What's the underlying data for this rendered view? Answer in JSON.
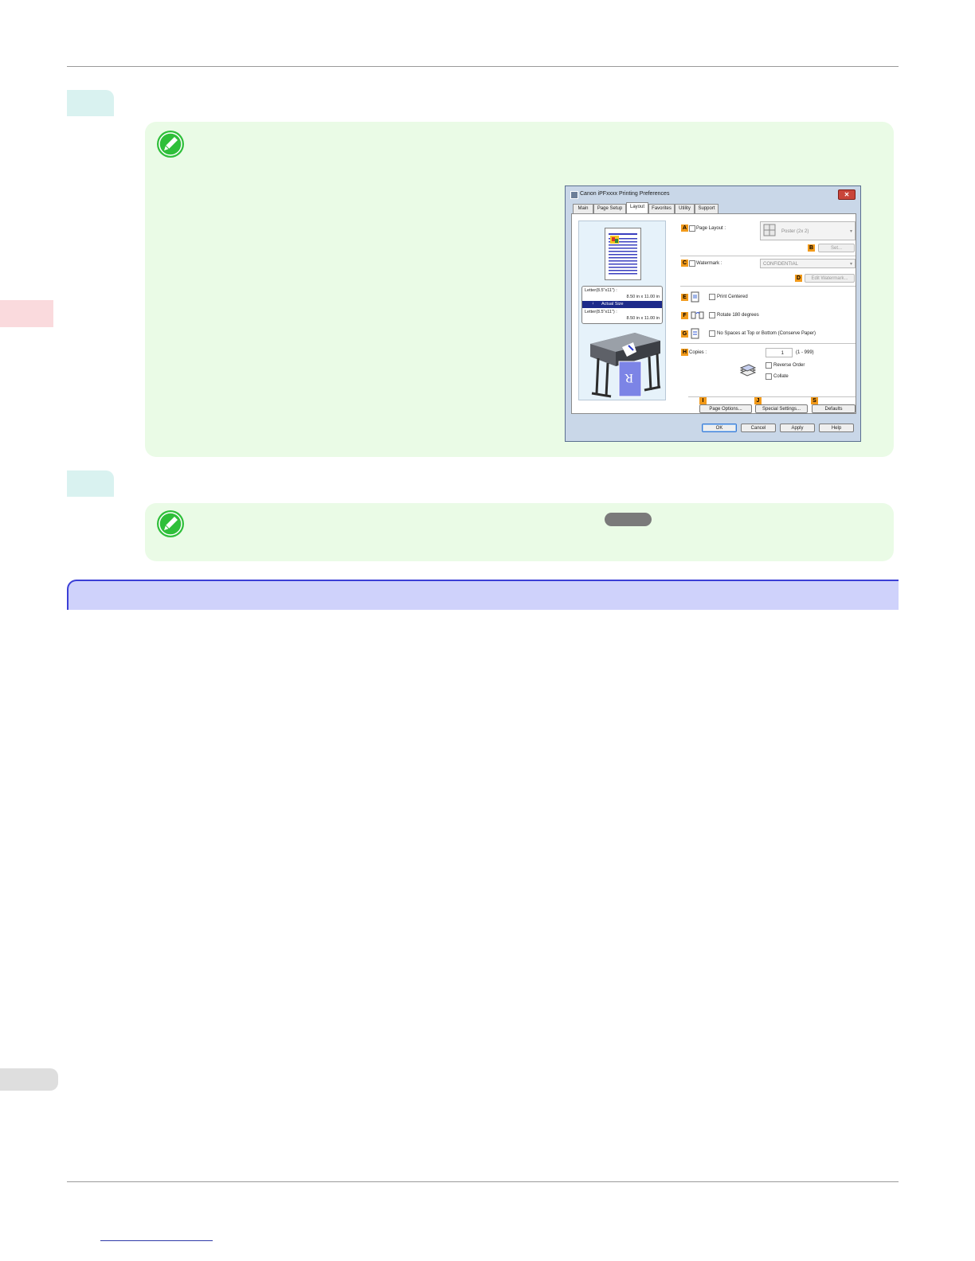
{
  "dialog": {
    "title": "Canon iPFxxxx Printing Preferences",
    "close_glyph": "✕",
    "tabs": [
      "Main",
      "Page Setup",
      "Layout",
      "Favorites",
      "Utility",
      "Support"
    ],
    "active_tab": "Layout",
    "preview": {
      "paper_line1": "Letter(8.5\"x11\") :",
      "paper_line2": "8.50 in x 11.00 in",
      "scaling": "Actual Size",
      "output_line1": "Letter(8.5\"x11\") :",
      "output_line2": "8.50 in x 11.00 in"
    },
    "markers": [
      "A",
      "B",
      "C",
      "D",
      "E",
      "F",
      "G",
      "H",
      "I",
      "J",
      "S"
    ],
    "page_layout_label": "Page Layout :",
    "page_layout_value": "Poster (2x 2)",
    "set_button": "Set...",
    "watermark_label": "Watermark :",
    "watermark_value": "CONFIDENTIAL",
    "edit_watermark_button": "Edit Watermark...",
    "print_centered": "Print Centered",
    "rotate_180": "Rotate 180 degrees",
    "no_spaces": "No Spaces at Top or Bottom (Conserve Paper)",
    "copies_label": "Copies :",
    "copies_value": "1",
    "copies_range": "(1 - 999)",
    "reverse_order": "Reverse Order",
    "collate": "Collate",
    "page_options_button": "Page Options...",
    "special_settings_button": "Special Settings...",
    "defaults_button": "Defaults",
    "ok_button": "OK",
    "cancel_button": "Cancel",
    "apply_button": "Apply",
    "help_button": "Help"
  },
  "colors": {
    "step_bg": "#d9f2f0",
    "note_bg": "#eafbe6",
    "section_bg": "#cfd2fb",
    "section_border": "#3b3fd6",
    "marker": "#f29a1a"
  }
}
